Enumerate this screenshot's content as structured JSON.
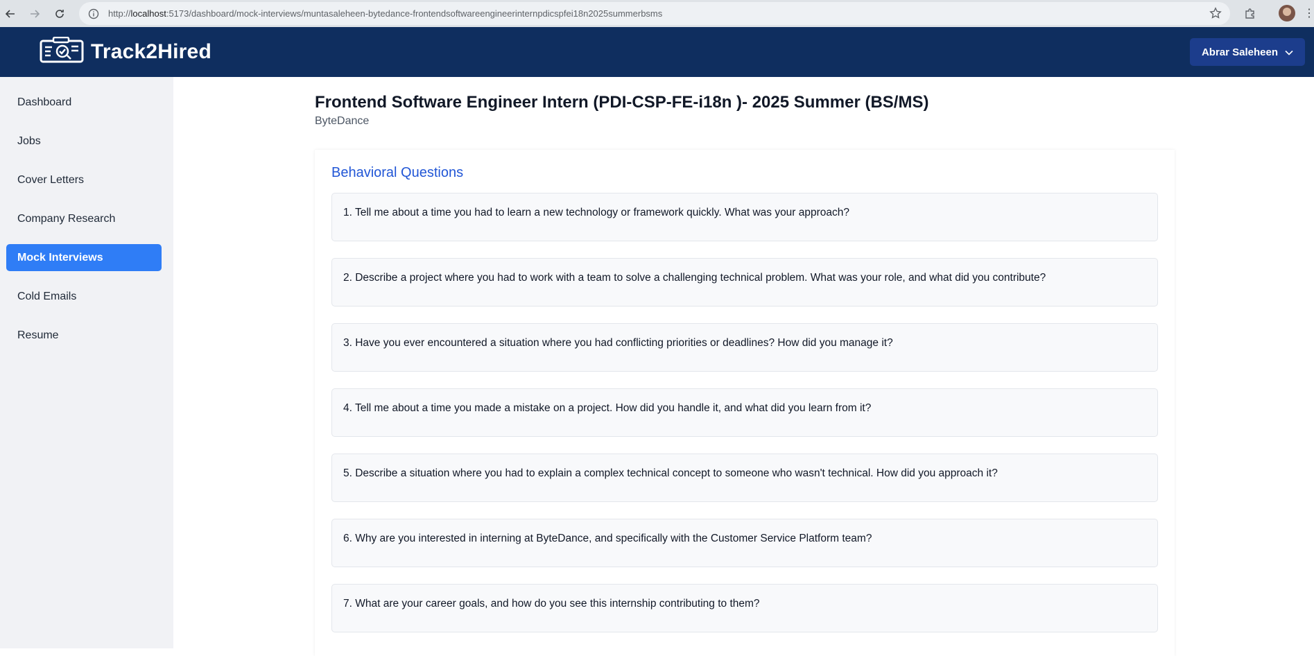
{
  "browser": {
    "url_prefix": "http://",
    "url_host": "localhost",
    "url_rest": ":5173/dashboard/mock-interviews/muntasaleheen-bytedance-frontendsoftwareengineerinternpdicspfei18n2025summerbsms"
  },
  "header": {
    "brand": "Track2Hired",
    "user_name": "Abrar Saleheen"
  },
  "sidebar": {
    "items": [
      {
        "label": "Dashboard"
      },
      {
        "label": "Jobs"
      },
      {
        "label": "Cover Letters"
      },
      {
        "label": "Company Research"
      },
      {
        "label": "Mock Interviews",
        "active": true
      },
      {
        "label": "Cold Emails"
      },
      {
        "label": "Resume"
      }
    ]
  },
  "main": {
    "title": "Frontend Software Engineer Intern (PDI-CSP-FE-i18n )- 2025 Summer (BS/MS)",
    "company": "ByteDance",
    "section_title": "Behavioral Questions",
    "questions": [
      "1. Tell me about a time you had to learn a new technology or framework quickly. What was your approach?",
      "2. Describe a project where you had to work with a team to solve a challenging technical problem. What was your role, and what did you contribute?",
      "3. Have you ever encountered a situation where you had conflicting priorities or deadlines? How did you manage it?",
      "4. Tell me about a time you made a mistake on a project. How did you handle it, and what did you learn from it?",
      "5. Describe a situation where you had to explain a complex technical concept to someone who wasn't technical. How did you approach it?",
      "6. Why are you interested in interning at ByteDance, and specifically with the Customer Service Platform team?",
      "7. What are your career goals, and how do you see this internship contributing to them?"
    ]
  },
  "colors": {
    "header_bg": "#0f2e5f",
    "user_button": "#1c3d8c",
    "active_nav": "#2f7df6",
    "section_title": "#2156d6"
  }
}
